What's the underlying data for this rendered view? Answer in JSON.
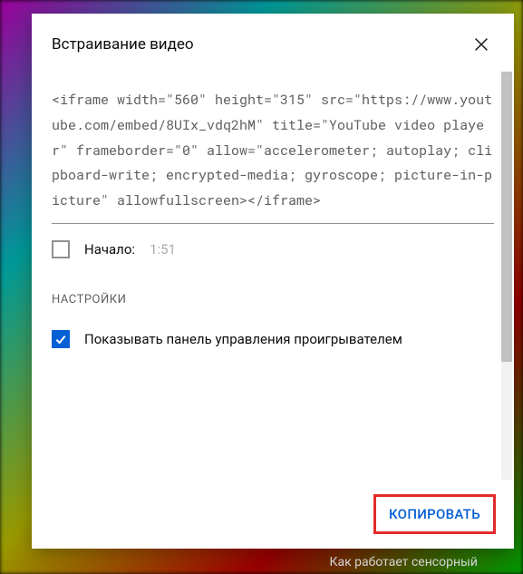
{
  "dialog": {
    "title": "Встраивание видео",
    "embedCode": "<iframe width=\"560\" height=\"315\" src=\"https://www.youtube.com/embed/8UIx_vdq2hM\" title=\"YouTube video player\" frameborder=\"0\" allow=\"accelerometer; autoplay; clipboard-write; encrypted-media; gyroscope; picture-in-picture\" allowfullscreen></iframe>",
    "startAt": {
      "label": "Начало:",
      "time": "1:51",
      "checked": false
    },
    "settings": {
      "heading": "НАСТРОЙКИ",
      "options": [
        {
          "label": "Показывать панель управления проигрывателем",
          "checked": true
        }
      ]
    },
    "copyButton": "КОПИРОВАТЬ"
  },
  "background": {
    "bottomText": "Как работает сенсорный"
  }
}
